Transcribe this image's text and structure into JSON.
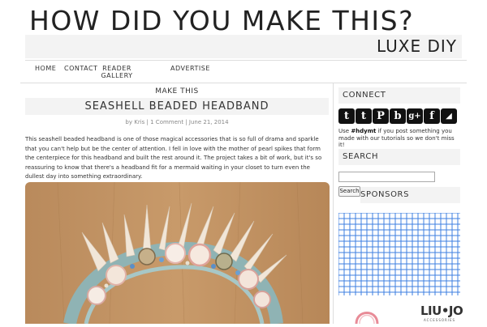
{
  "header": {
    "site_title": "HOW DID YOU MAKE THIS?",
    "tagline": "LUXE DIY"
  },
  "nav": {
    "items": [
      {
        "label": "HOME"
      },
      {
        "label": "CONTACT"
      },
      {
        "label": "READER GALLERY"
      },
      {
        "label": "ADVERTISE"
      }
    ]
  },
  "post": {
    "category": "MAKE THIS",
    "title": "SEASHELL BEADED HEADBAND",
    "meta": {
      "by": "by",
      "author": "Kris",
      "sep1": " | ",
      "comments": "1 Comment",
      "sep2": " | ",
      "date": "June 21, 2014"
    },
    "body": "This seashell beaded headband is one of those magical accessories that is so full of drama and sparkle that you can't help but be the center of attention. I fell in love with the mother of pearl spikes that form the centerpiece for this headband and built the rest around it. The project takes a bit of work, but it's so reassuring to know that there's a headband fit for a mermaid waiting in your closet to turn even the dullest day into something extraordinary."
  },
  "sidebar": {
    "connect_heading": "CONNECT",
    "social_icons": [
      {
        "name": "twitter-icon",
        "glyph": "t"
      },
      {
        "name": "tumblr-icon",
        "glyph": "t"
      },
      {
        "name": "pinterest-icon",
        "glyph": "P"
      },
      {
        "name": "bloglovin-icon",
        "glyph": "b"
      },
      {
        "name": "google-plus-icon",
        "glyph": "g+"
      },
      {
        "name": "facebook-icon",
        "glyph": "f"
      },
      {
        "name": "rss-icon",
        "glyph": "◢"
      }
    ],
    "hashtag_prefix": "Use ",
    "hashtag": "#hdymt",
    "hashtag_suffix": " if you post something you made with our tutorials so we don't miss it!",
    "search_heading": "SEARCH",
    "search_value": "",
    "search_button": "Search",
    "sponsors_heading": "SPONSORS",
    "sponsor_logo": "LIU•JO",
    "sponsor_sub": "ACCESSORIES"
  },
  "colors": {
    "bar_bg": "#f3f3f3",
    "grid_blue": "#3d7fe0",
    "icon_black": "#111111"
  }
}
